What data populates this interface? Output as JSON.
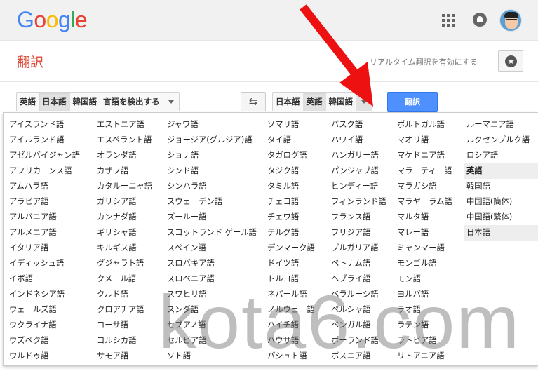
{
  "logo": {
    "letters": [
      "G",
      "o",
      "o",
      "g",
      "l",
      "e"
    ],
    "colors": [
      "#4285F4",
      "#EA4335",
      "#FBBC05",
      "#4285F4",
      "#34A853",
      "#EA4335"
    ]
  },
  "header": {
    "apps_icon": "apps-grid-icon",
    "notifications_icon": "bell-icon",
    "avatar": "user-avatar"
  },
  "page": {
    "title": "翻訳",
    "realtime_label": "リアルタイム翻訳を有効にする",
    "star_icon": "star-icon",
    "swap_icon": "swap-arrows-icon",
    "translate_label": "翻訳"
  },
  "source_langs": [
    "英語",
    "日本語",
    "韓国語",
    "言語を検出する"
  ],
  "target_langs": [
    "日本語",
    "英語",
    "韓国語"
  ],
  "language_columns": [
    [
      "アイスランド語",
      "アイルランド語",
      "アゼルバイジャン語",
      "アフリカーンス語",
      "アムハラ語",
      "アラビア語",
      "アルバニア語",
      "アルメニア語",
      "イタリア語",
      "イディッシュ語",
      "イボ語",
      "インドネシア語",
      "ウェールズ語",
      "ウクライナ語",
      "ウズベク語",
      "ウルドゥ語"
    ],
    [
      "エストニア語",
      "エスペラント語",
      "オランダ語",
      "カザフ語",
      "カタルーニャ語",
      "ガリシア語",
      "カンナダ語",
      "ギリシャ語",
      "キルギス語",
      "グジャラト語",
      "クメール語",
      "クルド語",
      "クロアチア語",
      "コーサ語",
      "コルシカ語",
      "サモア語"
    ],
    [
      "ジャワ語",
      "ジョージア(グルジア)語",
      "ショナ語",
      "シンド語",
      "シンハラ語",
      "スウェーデン語",
      "ズールー語",
      "スコットランド ゲール語",
      "スペイン語",
      "スロバキア語",
      "スロベニア語",
      "スワヒリ語",
      "スンダ語",
      "セブアノ語",
      "セルビア語",
      "ソト語"
    ],
    [
      "ソマリ語",
      "タイ語",
      "タガログ語",
      "タジク語",
      "タミル語",
      "チェコ語",
      "チェワ語",
      "テルグ語",
      "デンマーク語",
      "ドイツ語",
      "トルコ語",
      "ネパール語",
      "ノルウェー語",
      "ハイチ語",
      "ハウサ語",
      "パシュト語"
    ],
    [
      "バスク語",
      "ハワイ語",
      "ハンガリー語",
      "パンジャブ語",
      "ヒンディー語",
      "フィンランド語",
      "フランス語",
      "フリジア語",
      "ブルガリア語",
      "ベトナム語",
      "ヘブライ語",
      "ベラルーシ語",
      "ペルシャ語",
      "ベンガル語",
      "ポーランド語",
      "ボスニア語"
    ],
    [
      "ポルトガル語",
      "マオリ語",
      "マケドニア語",
      "マラーティー語",
      "マラガシ語",
      "マラヤーラム語",
      "マルタ語",
      "マレー語",
      "ミャンマー語",
      "モンゴル語",
      "モン語",
      "ヨルバ語",
      "ラオ語",
      "ラテン語",
      "ラトビア語",
      "リトアニア語"
    ],
    [
      "ルーマニア語",
      "ルクセンブルク語",
      "ロシア語",
      "英語",
      "韓国語",
      "中国語(簡体)",
      "中国語(繁体)",
      "日本語"
    ]
  ],
  "highlighted": {
    "bold": "英語",
    "selected": "日本語"
  },
  "watermark": "kota6.com",
  "annotation_arrow_color": "#ee1111"
}
